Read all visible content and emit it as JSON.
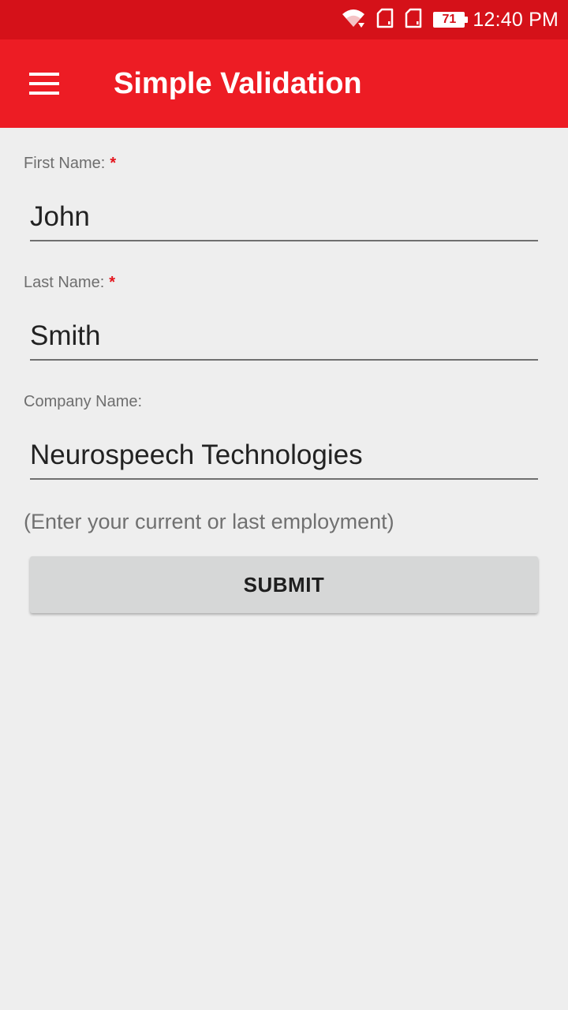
{
  "status_bar": {
    "icons": [
      "wifi-icon",
      "sim-card-1-icon",
      "sim-card-2-icon",
      "battery-icon"
    ],
    "battery_level": "71",
    "time": "12:40 PM"
  },
  "app_bar": {
    "menu_icon": "hamburger-menu-icon",
    "title": "Simple Validation",
    "background_color": "#ed1c24",
    "status_color": "#d51119"
  },
  "form": {
    "first_name": {
      "label": "First Name:",
      "required_marker": "*",
      "value": "John"
    },
    "last_name": {
      "label": "Last Name:",
      "required_marker": "*",
      "value": "Smith"
    },
    "company_name": {
      "label": "Company Name:",
      "value": "Neurospeech Technologies"
    },
    "company_hint": "(Enter your current or last employment)",
    "submit_label": "SUBMIT"
  }
}
